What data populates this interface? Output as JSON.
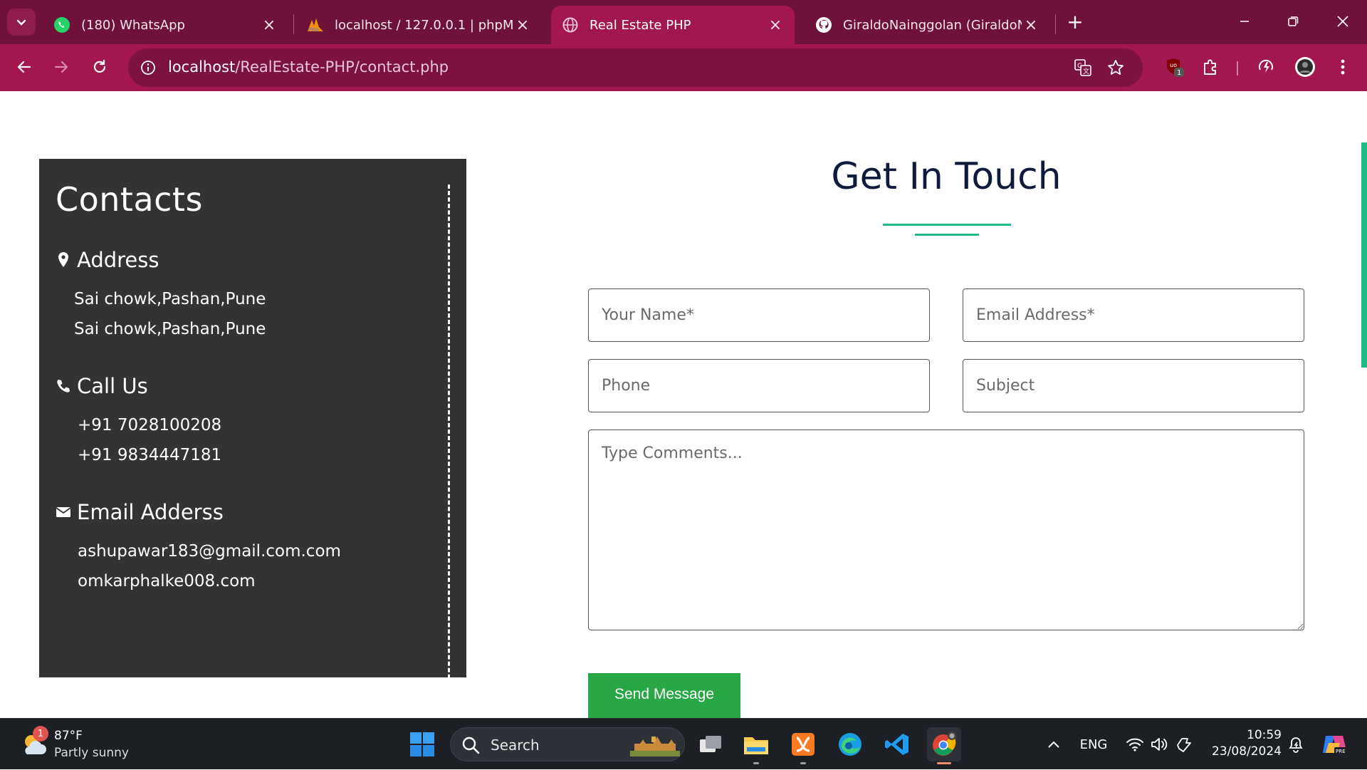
{
  "browser": {
    "tabs": [
      {
        "title": "(180) WhatsApp",
        "icon": "whatsapp-icon",
        "active": false
      },
      {
        "title": "localhost / 127.0.0.1 | phpMyAd",
        "icon": "phpmyadmin-icon",
        "active": false
      },
      {
        "title": "Real Estate PHP",
        "icon": "globe-icon",
        "active": true
      },
      {
        "title": "GiraldoNainggolan (GiraldoNai",
        "icon": "github-icon",
        "active": false
      }
    ],
    "url_host": "localhost",
    "url_path": "/RealEstate-PHP/contact.php",
    "theme_color": "#a3174f",
    "extension_badge": "1"
  },
  "page": {
    "contacts": {
      "title": "Contacts",
      "address_heading": "Address",
      "address_lines": [
        "Sai chowk,Pashan,Pune",
        "Sai chowk,Pashan,Pune"
      ],
      "call_heading": "Call Us",
      "phones": [
        "+91 7028100208",
        "+91 9834447181"
      ],
      "email_heading": "Email Adderss",
      "emails": [
        "ashupawar183@gmail.com.com",
        "omkarphalke008.com"
      ]
    },
    "form": {
      "title": "Get In Touch",
      "name_placeholder": "Your Name*",
      "email_placeholder": "Email Address*",
      "phone_placeholder": "Phone",
      "subject_placeholder": "Subject",
      "comments_placeholder": "Type Comments...",
      "send_label": "Send Message",
      "accent_color": "#21b98a",
      "button_color": "#28a745"
    }
  },
  "taskbar": {
    "weather_temp": "87°F",
    "weather_condition": "Partly sunny",
    "weather_badge": "1",
    "search_label": "Search",
    "language": "ENG",
    "time": "10:59",
    "date": "23/08/2024"
  }
}
